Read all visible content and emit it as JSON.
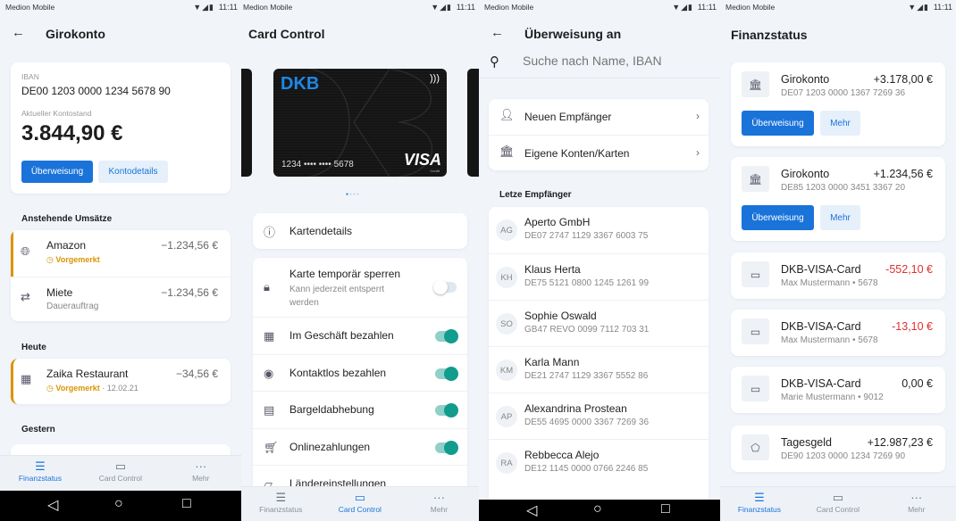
{
  "status_bar": {
    "carrier": "Medion Mobile",
    "time": "11:11",
    "icons": "▼◢▮"
  },
  "bottom_nav": [
    {
      "label": "Finanzstatus",
      "icon": "stack-icon"
    },
    {
      "label": "Card Control",
      "icon": "cards-icon"
    },
    {
      "label": "Mehr",
      "icon": "more-icon"
    }
  ],
  "giro": {
    "title": "Girokonto",
    "iban_label": "IBAN",
    "iban": "DE00 1203 0000 1234 5678 90",
    "balance_label": "Aktueller Kontostand",
    "balance": "3.844,90 €",
    "transfer_button": "Überweisung",
    "details_button": "Kontodetails",
    "pending_title": "Anstehende Umsätze",
    "pending": [
      {
        "name": "Amazon",
        "status": "Vorgemerkt",
        "amount": "−1.234,56 €",
        "icon": "globe-icon"
      },
      {
        "name": "Miete",
        "sub": "Dauerauftrag",
        "amount": "−1.234,56 €",
        "icon": "repeat-icon"
      }
    ],
    "today_title": "Heute",
    "today": {
      "name": "Zaika Restaurant",
      "status": "Vorgemerkt",
      "date": "· 12.02.21",
      "amount": "−34,56 €",
      "icon": "store-icon"
    },
    "yesterday_title": "Gestern"
  },
  "card_control": {
    "title": "Card Control",
    "card": {
      "brand": "DKB",
      "number": "1234 •••• •••• 5678",
      "network": "VISA",
      "network_sub": "Credit"
    },
    "details_label": "Kartendetails",
    "settings": [
      {
        "label": "Karte temporär sperren",
        "sub": "Kann jederzeit entsperrt werden",
        "on": false,
        "icon": "lock-icon"
      },
      {
        "label": "Im Geschäft bezahlen",
        "on": true,
        "icon": "store-icon"
      },
      {
        "label": "Kontaktlos bezahlen",
        "on": true,
        "icon": "contactless-icon"
      },
      {
        "label": "Bargeldabhebung",
        "on": true,
        "icon": "cash-icon"
      },
      {
        "label": "Onlinezahlungen",
        "on": true,
        "icon": "cart-icon"
      },
      {
        "label": "Ländereinstellungen",
        "icon": "map-icon"
      }
    ]
  },
  "transfer": {
    "title": "Überweisung an",
    "search_placeholder": "Suche nach Name, IBAN",
    "options": [
      {
        "label": "Neuen Empfänger",
        "icon": "person-icon"
      },
      {
        "label": "Eigene Konten/Karten",
        "icon": "bank-icon"
      }
    ],
    "recent_title": "Letze Empfänger",
    "recipients": [
      {
        "initials": "AG",
        "name": "Aperto GmbH",
        "iban": "DE07 2747 1129 3367 6003 75"
      },
      {
        "initials": "KH",
        "name": "Klaus Herta",
        "iban": "DE75 5121 0800 1245 1261 99"
      },
      {
        "initials": "SO",
        "name": "Sophie Oswald",
        "iban": "GB47 REVO 0099 7112 703 31"
      },
      {
        "initials": "KM",
        "name": "Karla Mann",
        "iban": "DE21 2747 1129 3367 5552 86"
      },
      {
        "initials": "AP",
        "name": "Alexandrina Prostean",
        "iban": "DE55 4695 0000 3367 7269 36"
      },
      {
        "initials": "RA",
        "name": "Rebbecca Alejo",
        "iban": "DE12 1145 0000 0766 2246 85"
      }
    ]
  },
  "finanzstatus": {
    "title": "Finanzstatus",
    "accounts": [
      {
        "name": "Girokonto",
        "sub": "DE07 1203 0000 1367 7269  36",
        "amount": "+3.178,00 €",
        "icon": "bank-icon",
        "buttons": [
          "Überweisung",
          "Mehr"
        ]
      },
      {
        "name": "Girokonto",
        "sub": "DE85 1203 0000 3451 3367 20",
        "amount": "+1.234,56 €",
        "icon": "bank-icon",
        "buttons": [
          "Überweisung",
          "Mehr"
        ]
      },
      {
        "name": "DKB-VISA-Card",
        "sub": "Max Mustermann • 5678",
        "amount": "-552,10 €",
        "negative": true,
        "icon": "card-icon"
      },
      {
        "name": "DKB-VISA-Card",
        "sub": "Max Mustermann • 5678",
        "amount": "-13,10 €",
        "negative": true,
        "icon": "card-icon"
      },
      {
        "name": "DKB-VISA-Card",
        "sub": "Marie Mustermann • 9012",
        "amount": "0,00 €",
        "icon": "card-icon"
      },
      {
        "name": "Tagesgeld",
        "sub": "DE90 1203 0000 1234 7269  90",
        "amount": "+12.987,23 €",
        "icon": "piggy-bank-icon"
      }
    ]
  },
  "colors": {
    "accent": "#1a73d9",
    "pending": "#d99400",
    "toggle": "#119c8e",
    "negative": "#e03030",
    "background": "#f1f5fa"
  }
}
